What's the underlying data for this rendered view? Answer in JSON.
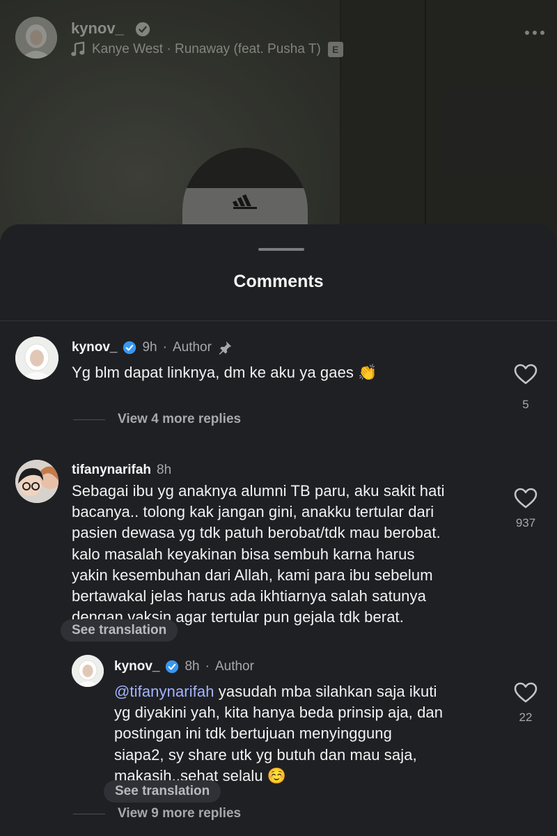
{
  "post": {
    "username": "kynov_",
    "music": "Kanye West · Runaway (feat. Pusha T)",
    "explicit_badge": "E"
  },
  "sheet": {
    "title": "Comments"
  },
  "comments": [
    {
      "username": "kynov_",
      "time": "9h",
      "author_label": "Author",
      "text": "Yg blm dapat linknya, dm ke aku ya gaes 👏",
      "likes": "5",
      "view_replies": "View 4 more replies"
    },
    {
      "username": "tifanynarifah",
      "time": "8h",
      "text_lines": [
        "Sebagai ibu yg anaknya alumni TB paru, aku sakit hati",
        "bacanya.. tolong kak jangan gini, anakku tertular dari",
        "pasien dewasa yg tdk patuh berobat/tdk mau berobat.",
        "kalo masalah keyakinan bisa sembuh karna harus",
        "yakin kesembuhan dari Allah, kami para ibu sebelum",
        "bertawakal jelas harus ada ikhtiarnya salah satunya",
        "dengan vaksin agar tertular pun gejala tdk berat."
      ],
      "likes": "937",
      "see_translation": "See translation"
    }
  ],
  "reply": {
    "username": "kynov_",
    "time": "8h",
    "author_label": "Author",
    "mention": "@tifanynarifah",
    "text_first": " yasudah mba silahkan saja ikuti",
    "text_lines": [
      "yg diyakini yah, kita hanya beda prinsip aja, dan",
      "postingan ini tdk bertujuan menyinggung",
      "siapa2, sy share utk yg butuh dan mau saja,",
      "makasih..sehat selalu ☺️"
    ],
    "likes": "22",
    "see_translation": "See translation",
    "view_replies": "View 9 more replies"
  },
  "colors": {
    "sheet_bg": "#1f2024",
    "verified": "#3897f0",
    "mention": "#a3b4ff",
    "secondary_text": "#a8a8ab"
  },
  "icons": [
    "verified-badge-icon",
    "music-note-icon",
    "more-options-icon",
    "pin-icon",
    "heart-icon"
  ]
}
